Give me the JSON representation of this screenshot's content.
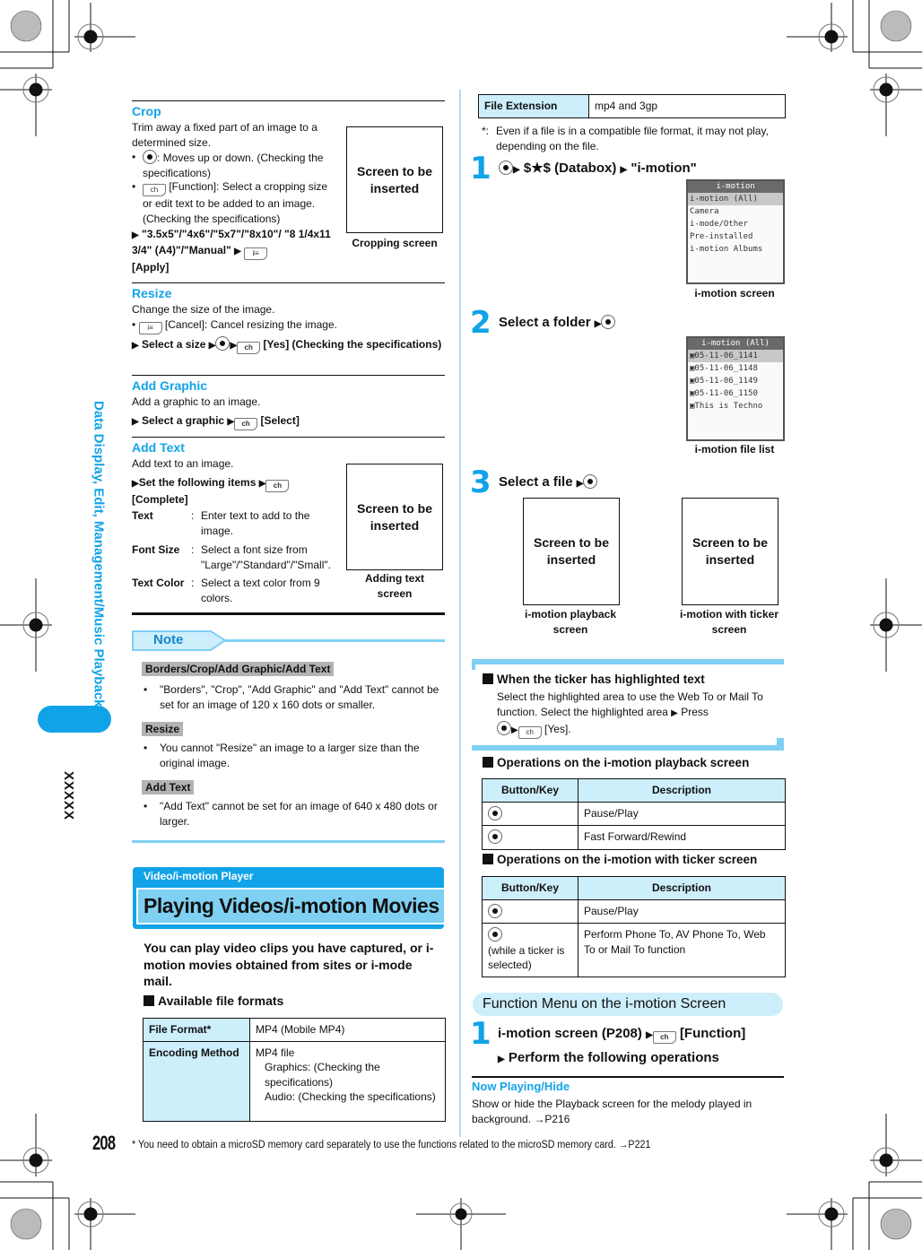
{
  "side_tab": {
    "chapter_title": "Data Display, Edit, Management/Music Playback",
    "index_label": "XXXXX",
    "accent_color": "#11a3e8"
  },
  "page_number": "208",
  "footer_note": "* You need to obtain a microSD memory card separately to use the functions related to the microSD memory card. →P221",
  "left": {
    "crop": {
      "title": "Crop",
      "desc": "Trim away a fixed part of an image to a determined size.",
      "bullets": [
        ": Moves up or down. (Checking the specifications)",
        "[Function]: Select a cropping size or edit text to be added to an image. (Checking the specifications)"
      ],
      "step_options": "\"3.5x5\"/\"4x6\"/\"5x7\"/\"8x10\"/ \"8 1/4x11 3/4\" (A4)\"/\"Manual\"",
      "step_end": "[Apply]",
      "screen_placeholder": "Screen to be inserted",
      "screen_caption": "Cropping screen"
    },
    "resize": {
      "title": "Resize",
      "desc": "Change the size of the image.",
      "bullet": "[Cancel]: Cancel resizing the image.",
      "step_a": "Select a size",
      "step_b": "[Yes] (Checking the specifications)"
    },
    "add_graphic": {
      "title": "Add Graphic",
      "desc": "Add a graphic to an image.",
      "step_a": "Select a graphic",
      "step_b": "[Select]"
    },
    "add_text": {
      "title": "Add Text",
      "desc": "Add text to an image.",
      "step_a": "Set the following items",
      "step_b": "[Complete]",
      "items": [
        {
          "term": "Text",
          "def": "Enter text to add to the image."
        },
        {
          "term": "Font Size",
          "def": "Select a font size from \"Large\"/\"Standard\"/\"Small\"."
        },
        {
          "term": "Text Color",
          "def": "Select a text color from 9 colors."
        }
      ],
      "screen_placeholder": "Screen to be inserted",
      "screen_caption": "Adding text screen"
    },
    "note": {
      "label": "Note",
      "groups": [
        {
          "heading": "Borders/Crop/Add Graphic/Add Text",
          "text": "\"Borders\", \"Crop\", \"Add Graphic\" and \"Add Text\" cannot be set for an image of 120 x 160 dots or smaller."
        },
        {
          "heading": "Resize",
          "text": "You cannot \"Resize\" an image to a larger size than the original image."
        },
        {
          "heading": "Add Text",
          "text": "\"Add Text\" cannot be set for an image of 640 x 480 dots or larger."
        }
      ]
    },
    "section_banner": {
      "category": "Video/i-motion Player",
      "title": "Playing Videos/i-motion Movies"
    },
    "intro": "You can play video clips you have captured, or i-motion movies obtained from sites or i-mode mail.",
    "formats_heading": "Available file formats",
    "formats_table": [
      {
        "key": "File Format*",
        "value": "MP4 (Mobile MP4)"
      },
      {
        "key": "Encoding Method",
        "value_lines": [
          "MP4 file",
          "Graphics: (Checking the specifications)",
          "Audio: (Checking the specifications)"
        ]
      }
    ]
  },
  "right": {
    "ext_row": {
      "key": "File Extension",
      "value": "mp4 and 3gp"
    },
    "footnote_mark": "*:",
    "footnote": "Even if a file is in a compatible file format, it may not play, depending on the file.",
    "step1": {
      "num": "1",
      "text_a": "$★$ (Databox)",
      "text_b": "\"i-motion\"",
      "screen": {
        "title": "i-motion",
        "rows": [
          "i-motion (All)",
          "Camera",
          "i-mode/Other",
          "Pre-installed",
          "i-motion Albums"
        ],
        "selected": 0
      },
      "caption": "i-motion screen"
    },
    "step2": {
      "num": "2",
      "text": "Select a folder",
      "screen": {
        "title": "i-motion (All)",
        "rows": [
          "05-11-06_1141",
          "05-11-06_1148",
          "05-11-06_1149",
          "05-11-06_1150",
          "This is Techno"
        ],
        "selected": 0
      },
      "caption": "i-motion file list"
    },
    "step3": {
      "num": "3",
      "text": "Select a file",
      "screens": [
        {
          "placeholder": "Screen to be inserted",
          "caption": "i-motion playback screen"
        },
        {
          "placeholder": "Screen to be inserted",
          "caption": "i-motion with ticker screen"
        }
      ]
    },
    "ticker_box": {
      "heading": "When the ticker has highlighted text",
      "text_a": "Select the highlighted area to use the Web To or Mail To function. Select the highlighted area",
      "text_b": "Press",
      "text_c": "[Yes]."
    },
    "playback_ops": {
      "heading": "Operations on the i-motion playback screen",
      "columns": [
        "Button/Key",
        "Description"
      ],
      "rows": [
        {
          "key_icon": "center-key-icon",
          "key_note": "",
          "desc": "Pause/Play"
        },
        {
          "key_icon": "left-right-key-icon",
          "key_note": "",
          "desc": "Fast Forward/Rewind"
        }
      ]
    },
    "ticker_ops": {
      "heading": "Operations on the i-motion with ticker screen",
      "columns": [
        "Button/Key",
        "Description"
      ],
      "rows": [
        {
          "key_icon": "center-key-icon",
          "key_note": "",
          "desc": "Pause/Play"
        },
        {
          "key_icon": "center-key-icon",
          "key_note": "(while a ticker is selected)",
          "desc": "Perform Phone To, AV Phone To, Web To or Mail To function"
        }
      ]
    },
    "function_menu": {
      "title": "Function Menu on the i-motion Screen",
      "step_num": "1",
      "step_a": "i-motion screen (P208)",
      "step_b": "[Function]",
      "step_c": "Perform the following operations"
    },
    "now_playing": {
      "title": "Now Playing/Hide",
      "text": "Show or hide the Playback screen for the melody played in background. →P216"
    }
  }
}
